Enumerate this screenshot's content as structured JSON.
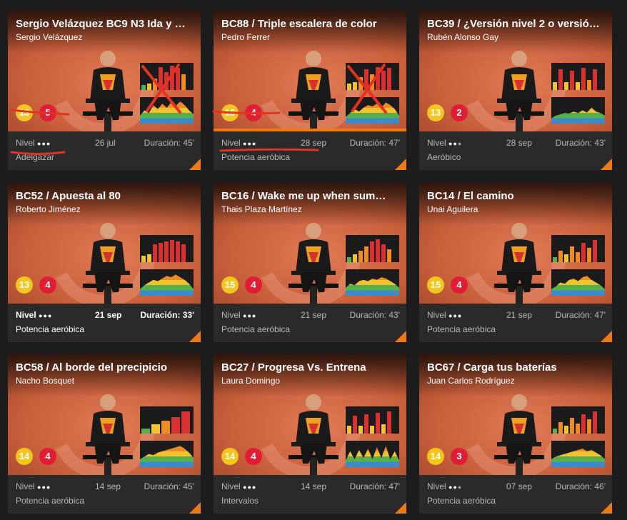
{
  "cards": [
    {
      "title": "Sergio Velázquez BC9 N3 Ida y …",
      "instructor": "Sergio Velázquez",
      "level": "13",
      "difficulty": "5",
      "nivel_label": "Nivel",
      "dots": "●●●",
      "date": "26 jul",
      "duration": "Duración: 45'",
      "category": "Adelgazar",
      "bars": [
        20,
        25,
        45,
        90,
        70,
        95,
        85,
        60
      ],
      "zones": [
        30,
        50,
        40,
        70,
        55,
        75,
        60,
        80,
        65,
        85,
        70,
        50,
        35
      ]
    },
    {
      "title": "BC88 / Triple escalera de color",
      "instructor": "Pedro Ferrer",
      "level": "16",
      "difficulty": "4",
      "nivel_label": "Nivel",
      "dots": "●●●",
      "date": "28 sep",
      "duration": "Duración: 47'",
      "category": "Potencia aeróbica",
      "bars": [
        25,
        30,
        50,
        80,
        60,
        90,
        75,
        85
      ],
      "zones": [
        25,
        40,
        55,
        45,
        60,
        70,
        65,
        75,
        60,
        80,
        70,
        55,
        30
      ]
    },
    {
      "title": "BC39 / ¿Versión nivel 2 o versió…",
      "instructor": "Rubén Alonso Gay",
      "level": "13",
      "difficulty": "2",
      "nivel_label": "Nivel",
      "dots": "●●●",
      "date": "28 sep",
      "duration": "Duración: 43'",
      "category": "Aeróbico",
      "bars": [
        30,
        80,
        30,
        75,
        30,
        85,
        40,
        80
      ],
      "zones": [
        20,
        30,
        35,
        40,
        38,
        45,
        40,
        50,
        42,
        60,
        45,
        40,
        30
      ]
    },
    {
      "title": "BC52 / Apuesta al 80",
      "instructor": "Roberto Jiménez",
      "level": "13",
      "difficulty": "4",
      "nivel_label": "Nivel",
      "dots": "●●●",
      "date": "21 sep",
      "duration": "Duración: 33'",
      "category": "Potencia aeróbica",
      "bars": [
        25,
        30,
        70,
        75,
        80,
        85,
        80,
        70
      ],
      "zones": [
        25,
        40,
        50,
        60,
        55,
        65,
        75,
        70,
        80,
        70,
        60,
        45,
        25
      ]
    },
    {
      "title": "BC16 / Wake me up when sum…",
      "instructor": "Thais Plaza Martínez",
      "level": "15",
      "difficulty": "4",
      "nivel_label": "Nivel",
      "dots": "●●●",
      "date": "21 sep",
      "duration": "Duración: 43'",
      "category": "Potencia aeróbica",
      "bars": [
        20,
        30,
        45,
        60,
        80,
        90,
        70,
        50
      ],
      "zones": [
        30,
        45,
        40,
        55,
        60,
        55,
        65,
        60,
        70,
        65,
        55,
        45,
        30
      ]
    },
    {
      "title": "BC14 / El camino",
      "instructor": "Unai Aguilera",
      "level": "15",
      "difficulty": "4",
      "nivel_label": "Nivel",
      "dots": "●●●",
      "date": "21 sep",
      "duration": "Duración: 47'",
      "category": "Potencia aeróbica",
      "bars": [
        20,
        45,
        30,
        60,
        40,
        75,
        55,
        85
      ],
      "zones": [
        25,
        35,
        50,
        45,
        60,
        65,
        55,
        70,
        75,
        60,
        50,
        40,
        25
      ]
    },
    {
      "title": "BC58 / Al borde del precipicio",
      "instructor": "Nacho Bosquet",
      "level": "14",
      "difficulty": "4",
      "nivel_label": "Nivel",
      "dots": "●●●",
      "date": "14 sep",
      "duration": "Duración: 45'",
      "category": "Potencia aeróbica",
      "bars": [
        20,
        35,
        50,
        65,
        85
      ],
      "zones": [
        30,
        40,
        50,
        45,
        55,
        60,
        65,
        70,
        75,
        80,
        70,
        55,
        35
      ]
    },
    {
      "title": "BC27 / Progresa Vs. Entrena",
      "instructor": "Laura Domingo",
      "level": "14",
      "difficulty": "4",
      "nivel_label": "Nivel",
      "dots": "●●●",
      "date": "14 sep",
      "duration": "Duración: 47'",
      "category": "Intervalos",
      "bars": [
        30,
        70,
        30,
        75,
        30,
        80,
        35,
        85
      ],
      "zones": [
        25,
        60,
        30,
        65,
        35,
        70,
        30,
        75,
        35,
        80,
        30,
        60,
        25
      ]
    },
    {
      "title": "BC67 / Carga tus baterías",
      "instructor": "Juan Carlos Rodríguez",
      "level": "14",
      "difficulty": "3",
      "nivel_label": "Nivel",
      "dots": "●●●",
      "date": "07 sep",
      "duration": "Duración: 46'",
      "category": "Potencia aeróbica",
      "bars": [
        20,
        45,
        30,
        60,
        40,
        75,
        55,
        85
      ],
      "zones": [
        30,
        40,
        45,
        50,
        55,
        60,
        65,
        70,
        60,
        65,
        55,
        45,
        30
      ]
    }
  ]
}
